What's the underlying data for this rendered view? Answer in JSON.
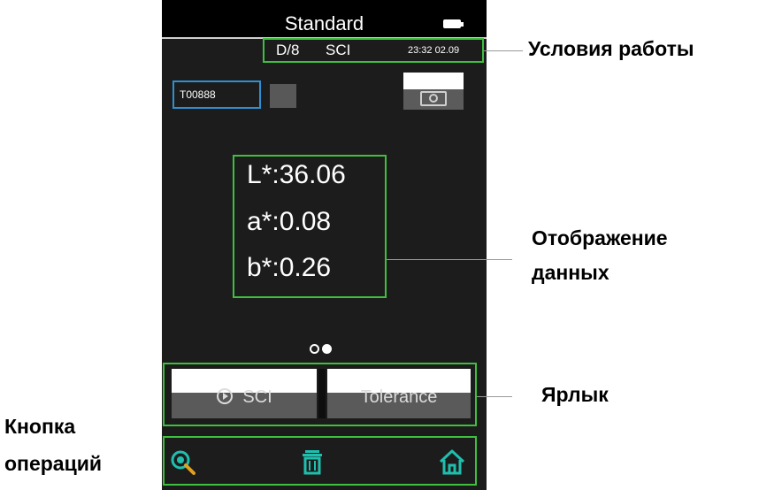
{
  "device": {
    "title": "Standard",
    "battery_icon": "battery-icon",
    "conditions": {
      "illumination": "D/8",
      "mode": "SCI",
      "datetime": "23:32  02.09"
    },
    "sample_id": "T00888",
    "camera_icon": "camera-icon",
    "measurements": {
      "l": "L*:36.06",
      "a": "a*:0.08",
      "b": "b*:0.26"
    },
    "page_indicator": {
      "pages": 2,
      "current": 2
    },
    "shortcuts": [
      {
        "label": "SCI",
        "icon": "play-circle-icon"
      },
      {
        "label": "Tolerance"
      }
    ],
    "operations": [
      {
        "icon": "search-icon"
      },
      {
        "icon": "trash-icon"
      },
      {
        "icon": "home-icon"
      }
    ]
  },
  "annotations": {
    "conditions": "Условия работы",
    "data_display_line1": "Отображение",
    "data_display_line2": "данных",
    "shortcut": "Ярлык",
    "operations_line1": "Кнопка",
    "operations_line2": "операций"
  },
  "colors": {
    "highlight": "#3fbf3f",
    "sample_border": "#2f8fd0",
    "icon_teal": "#1fbfae",
    "screen_bg": "#1c1c1c"
  }
}
